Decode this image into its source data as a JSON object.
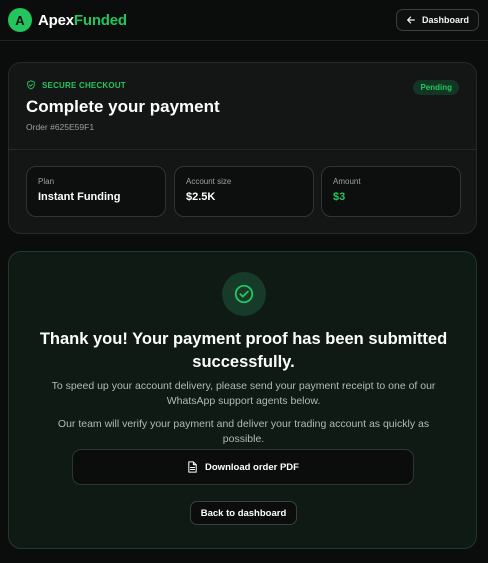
{
  "header": {
    "logo_letter": "A",
    "brand_part1": "Apex",
    "brand_part2": "Funded",
    "dashboard_button": "Dashboard"
  },
  "checkout": {
    "badge": "SECURE CHECKOUT",
    "status": "Pending",
    "title": "Complete your payment",
    "order": "Order #625E59F1",
    "details": [
      {
        "label": "Plan",
        "value": "Instant Funding"
      },
      {
        "label": "Account size",
        "value": "$2.5K"
      },
      {
        "label": "Amount",
        "value": "$3"
      }
    ]
  },
  "confirmation": {
    "headline": "Thank you! Your payment proof has been submitted successfully.",
    "paragraph1": "To speed up your account delivery, please send your payment receipt to one of our WhatsApp support agents below.",
    "paragraph2": "Our team will verify your payment and deliver your trading account as quickly as possible.",
    "download_button": "Download order PDF",
    "back_button": "Back to dashboard"
  },
  "colors": {
    "accent": "#22c55e",
    "background": "#0b0d0c",
    "card": "#131614",
    "success_card": "#0f1a15"
  }
}
